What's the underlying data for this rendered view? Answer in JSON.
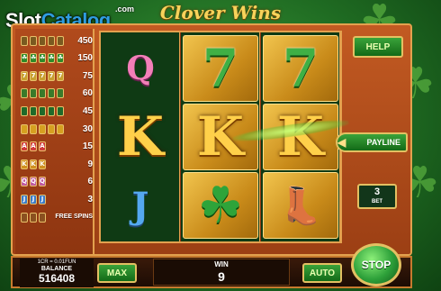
{
  "watermark": {
    "part1": "Slot",
    "part2": "Catalog",
    "suffix": ".com"
  },
  "game_title": "Clover Wins",
  "paytable": {
    "rows": [
      {
        "icons": [
          "bar-icon",
          "bar-icon",
          "bar-icon",
          "bar-icon",
          "bar-icon"
        ],
        "value": "450"
      },
      {
        "icons": [
          "clover-icon",
          "clover-icon",
          "clover-icon",
          "clover-icon",
          "clover-icon"
        ],
        "value": "150"
      },
      {
        "icons": [
          "seven-icon",
          "seven-icon",
          "seven-icon",
          "seven-icon",
          "seven-icon"
        ],
        "value": "75"
      },
      {
        "icons": [
          "boot-icon",
          "boot-icon",
          "boot-icon",
          "boot-icon",
          "boot-icon"
        ],
        "value": "60"
      },
      {
        "icons": [
          "hat-icon",
          "hat-icon",
          "hat-icon",
          "hat-icon",
          "hat-icon"
        ],
        "value": "45"
      },
      {
        "icons": [
          "gold-icon",
          "gold-icon",
          "gold-icon",
          "gold-icon",
          "gold-icon"
        ],
        "value": "30"
      },
      {
        "icons": [
          "a-icon",
          "a-icon",
          "a-icon"
        ],
        "value": "15"
      },
      {
        "icons": [
          "k-icon",
          "k-icon",
          "k-icon"
        ],
        "value": "9"
      },
      {
        "icons": [
          "q-icon",
          "q-icon",
          "q-icon"
        ],
        "value": "6"
      },
      {
        "icons": [
          "j-icon",
          "j-icon",
          "j-icon"
        ],
        "value": "3"
      },
      {
        "icons": [
          "scatter-icon",
          "scatter-icon",
          "scatter-icon"
        ],
        "value": "FREE SPINS"
      }
    ]
  },
  "reels": [
    [
      {
        "symbol": "Q",
        "style": "pink"
      },
      {
        "symbol": "K",
        "style": "letter"
      },
      {
        "symbol": "J",
        "style": "blue"
      }
    ],
    [
      {
        "symbol": "7",
        "style": "seven"
      },
      {
        "symbol": "K",
        "style": "letter"
      },
      {
        "symbol": "☘",
        "style": "clover"
      }
    ],
    [
      {
        "symbol": "7",
        "style": "seven"
      },
      {
        "symbol": "K",
        "style": "letter"
      },
      {
        "symbol": "👢",
        "style": "boot"
      }
    ]
  ],
  "buttons": {
    "help": "HELP",
    "payline": "PAYLINE",
    "max": "MAX",
    "auto": "AUTO",
    "stop": "STOP"
  },
  "bet": {
    "value": "3",
    "label": "BET"
  },
  "balance": {
    "rate": "1CR = 0.01FUN",
    "label": "BALANCE",
    "value": "516408"
  },
  "win": {
    "label": "WIN",
    "value": "9"
  },
  "colors": {
    "accent_gold": "#e3a14e",
    "button_green": "#2ea13a",
    "frame_red": "#b04a1c"
  }
}
